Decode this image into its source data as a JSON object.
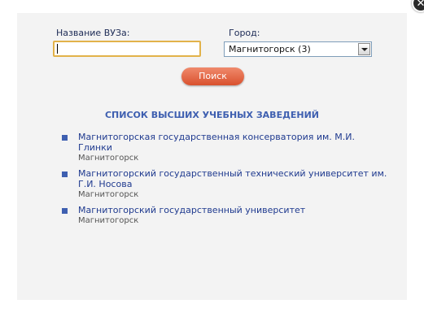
{
  "form": {
    "name_label": "Название ВУЗа:",
    "name_value": "",
    "city_label": "Город:",
    "city_selected": "Магнитогорск (3)",
    "search_label": "Поиск"
  },
  "close_icon_glyph": "✕",
  "list": {
    "title": "СПИСОК ВЫСШИХ УЧЕБНЫХ ЗАВЕДЕНИЙ",
    "items": [
      {
        "name": "Магнитогорская государственная консерватория им. М.И. Глинки",
        "city": "Магнитогорск"
      },
      {
        "name": "Магнитогорский государственный технический университет им. Г.И. Носова",
        "city": "Магнитогорск"
      },
      {
        "name": "Магнитогорский государственный университет",
        "city": "Магнитогорск"
      }
    ]
  },
  "colors": {
    "accent": "#3e5fb0",
    "button": "#e06a47",
    "panel": "#f3f3f3"
  }
}
